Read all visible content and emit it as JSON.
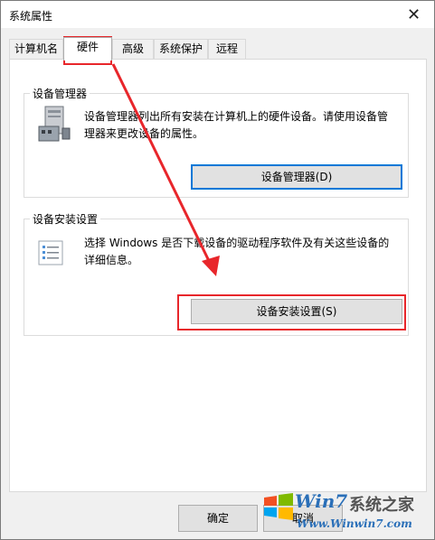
{
  "window": {
    "title": "系统属性",
    "close_glyph": "✕"
  },
  "tabs": [
    {
      "label": "计算机名"
    },
    {
      "label": "硬件",
      "active": true
    },
    {
      "label": "高级"
    },
    {
      "label": "系统保护"
    },
    {
      "label": "远程"
    }
  ],
  "device_manager": {
    "group_label": "设备管理器",
    "description": "设备管理器列出所有安装在计算机上的硬件设备。请使用设备管理器来更改设备的属性。",
    "button_label": "设备管理器(D)",
    "icon": "device-manager-icon"
  },
  "device_install": {
    "group_label": "设备安装设置",
    "description": "选择 Windows 是否下载设备的驱动程序软件及有关这些设备的详细信息。",
    "button_label": "设备安装设置(S)",
    "icon": "checklist-icon"
  },
  "footer": {
    "ok_label": "确定",
    "cancel_label": "取消"
  },
  "watermark": {
    "logo_text": "Win7",
    "site_name": "系统之家",
    "url": "Www.Winwin7.com"
  },
  "colors": {
    "highlight": "#e8262b",
    "focus": "#0078d7",
    "watermark_blue": "#2a6fb8"
  }
}
